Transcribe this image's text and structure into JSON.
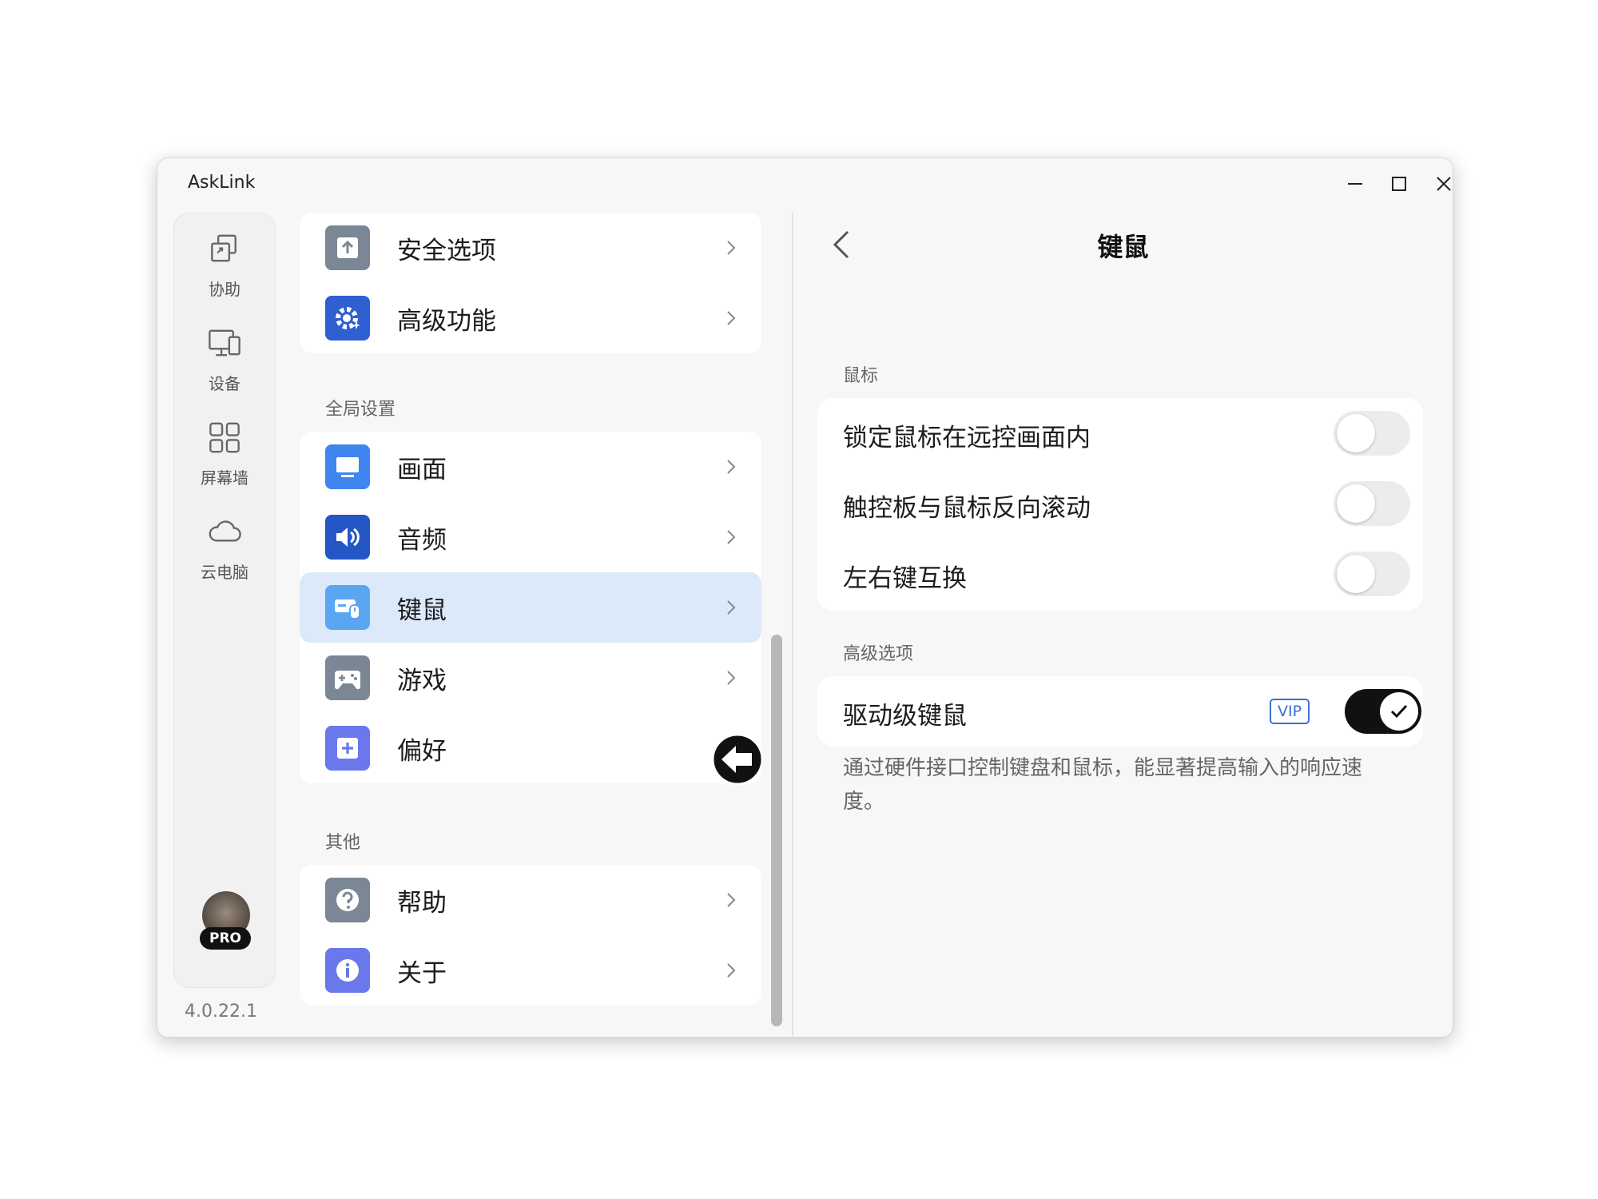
{
  "app": {
    "title": "AskLink",
    "version": "4.0.22.1"
  },
  "window_controls": {
    "minimize": "minimize-icon",
    "maximize": "maximize-icon",
    "close": "close-icon"
  },
  "rail": {
    "items": [
      {
        "label": "协助",
        "icon": "assist-icon"
      },
      {
        "label": "设备",
        "icon": "devices-icon"
      },
      {
        "label": "屏幕墙",
        "icon": "screen-wall-icon"
      },
      {
        "label": "云电脑",
        "icon": "cloud-icon"
      }
    ],
    "badge": "PRO"
  },
  "settings_list": {
    "top_items": [
      {
        "label": "安全选项",
        "icon": "security-icon",
        "color": "#7b8794"
      },
      {
        "label": "高级功能",
        "icon": "gear-icon",
        "color": "#2f5fd0"
      }
    ],
    "global_section": "全局设置",
    "global_items": [
      {
        "label": "画面",
        "icon": "display-icon",
        "color": "#3f86ee"
      },
      {
        "label": "音频",
        "icon": "audio-icon",
        "color": "#2457c5"
      },
      {
        "label": "键鼠",
        "icon": "keyboard-mouse-icon",
        "color": "#5ba6f3"
      },
      {
        "label": "游戏",
        "icon": "gamepad-icon",
        "color": "#7b8794"
      },
      {
        "label": "偏好",
        "icon": "preferences-icon",
        "color": "#6a78ec"
      }
    ],
    "other_section": "其他",
    "other_items": [
      {
        "label": "帮助",
        "icon": "help-icon",
        "color": "#7b8794"
      },
      {
        "label": "关于",
        "icon": "info-icon",
        "color": "#6a78ec"
      }
    ]
  },
  "panel": {
    "title": "键鼠",
    "mouse_section": "鼠标",
    "mouse_options": [
      {
        "label": "锁定鼠标在远控画面内",
        "enabled": false
      },
      {
        "label": "触控板与鼠标反向滚动",
        "enabled": false
      },
      {
        "label": "左右键互换",
        "enabled": false
      }
    ],
    "advanced_section": "高级选项",
    "advanced_option": {
      "label": "驱动级键鼠",
      "badge": "VIP",
      "enabled": true
    },
    "advanced_desc": "通过硬件接口控制键盘和鼠标，能显著提高输入的响应速度。"
  }
}
